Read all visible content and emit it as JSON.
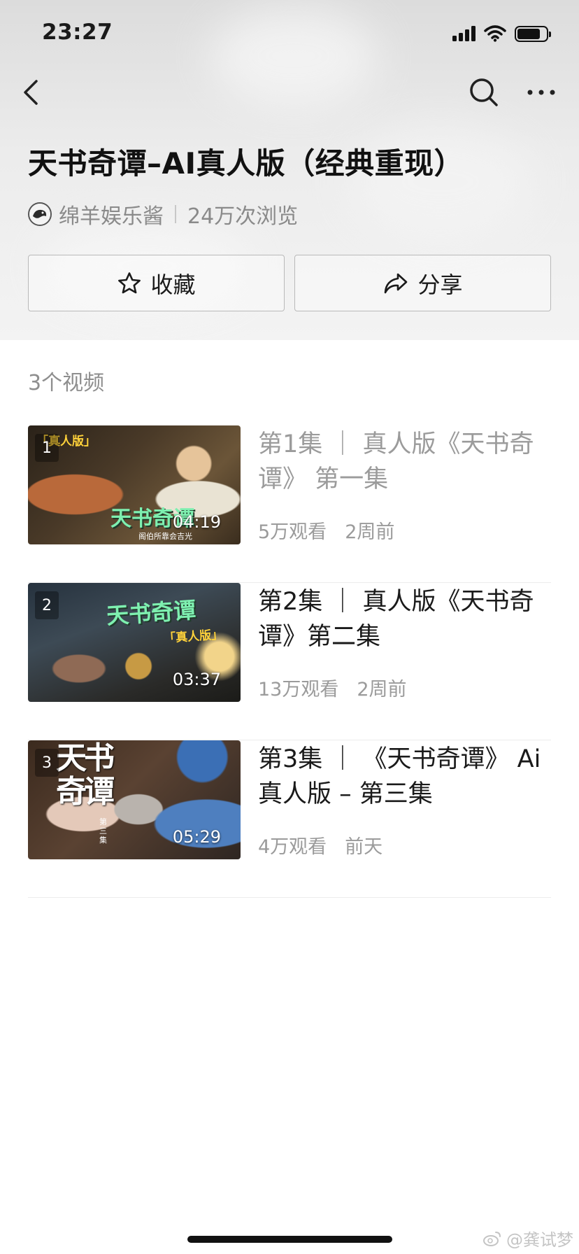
{
  "status_bar": {
    "time": "23:27",
    "battery_level": 0.8
  },
  "header": {
    "title": "天书奇谭–AI真人版（经典重现）",
    "author": "绵羊娱乐酱",
    "views": "24万次浏览"
  },
  "actions": {
    "favorite_label": "收藏",
    "share_label": "分享"
  },
  "playlist": {
    "count_label": "3个视频",
    "items": [
      {
        "index": "1",
        "title": "第1集 ｜ 真人版《天书奇谭》 第一集",
        "duration": "04:19",
        "views": "5万观看",
        "age": "2周前",
        "thumb_caption": "天书奇谭",
        "thumb_tag": "「真人版」",
        "thumb_sub": "阁伯所靠会吉光",
        "watched": true
      },
      {
        "index": "2",
        "title": "第2集 ｜ 真人版《天书奇谭》第二集",
        "duration": "03:37",
        "views": "13万观看",
        "age": "2周前",
        "thumb_caption": "天书奇谭",
        "thumb_tag": "「真人版」",
        "watched": false
      },
      {
        "index": "3",
        "title": "第3集 ｜ 《天书奇谭》 Ai真人版 – 第三集",
        "duration": "05:29",
        "views": "4万观看",
        "age": "前天",
        "thumb_caption": "天书奇谭",
        "thumb_side": "第三集",
        "watched": false
      }
    ]
  },
  "watermark": "@龚试梦",
  "icons": {
    "back": "chevron-left-icon",
    "search": "search-icon",
    "more": "more-icon",
    "favorite": "star-icon",
    "share": "share-icon",
    "weibo": "weibo-icon"
  }
}
